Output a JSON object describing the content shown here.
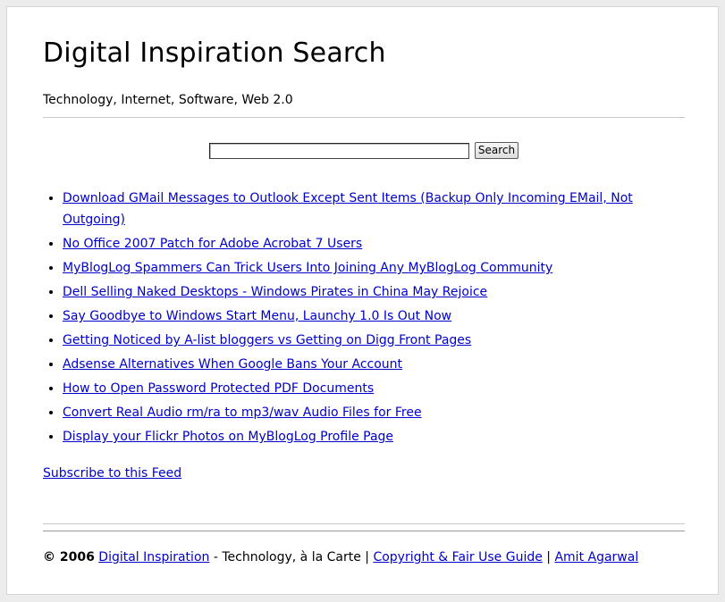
{
  "header": {
    "title": "Digital Inspiration Search",
    "tagline": "Technology, Internet, Software, Web 2.0"
  },
  "search": {
    "input_value": "",
    "button_label": "Search"
  },
  "posts": [
    {
      "label": "Download GMail Messages to Outlook Except Sent Items (Backup Only Incoming EMail, Not Outgoing)"
    },
    {
      "label": "No Office 2007 Patch for Adobe Acrobat 7 Users"
    },
    {
      "label": "MyBlogLog Spammers Can Trick Users Into Joining Any MyBlogLog Community"
    },
    {
      "label": "Dell Selling Naked Desktops - Windows Pirates in China May Rejoice"
    },
    {
      "label": "Say Goodbye to Windows Start Menu, Launchy 1.0 Is Out Now"
    },
    {
      "label": "Getting Noticed by A-list bloggers vs Getting on Digg Front Pages"
    },
    {
      "label": "Adsense Alternatives When Google Bans Your Account"
    },
    {
      "label": "How to Open Password Protected PDF Documents"
    },
    {
      "label": "Convert Real Audio rm/ra to mp3/wav Audio Files for Free"
    },
    {
      "label": "Display your Flickr Photos on MyBlogLog Profile Page"
    }
  ],
  "subscribe": {
    "label": " Subscribe to this Feed"
  },
  "footer": {
    "copyright": "© 2006",
    "site_link": "Digital Inspiration",
    "tagline_text": "- Technology, à la Carte |",
    "copyright_link": "Copyright & Fair Use Guide",
    "separator": "|",
    "author_link": "Amit Agarwal"
  },
  "colors": {
    "link": "#0000cc",
    "page_background": "#ffffff",
    "outer_background": "#ececec"
  }
}
